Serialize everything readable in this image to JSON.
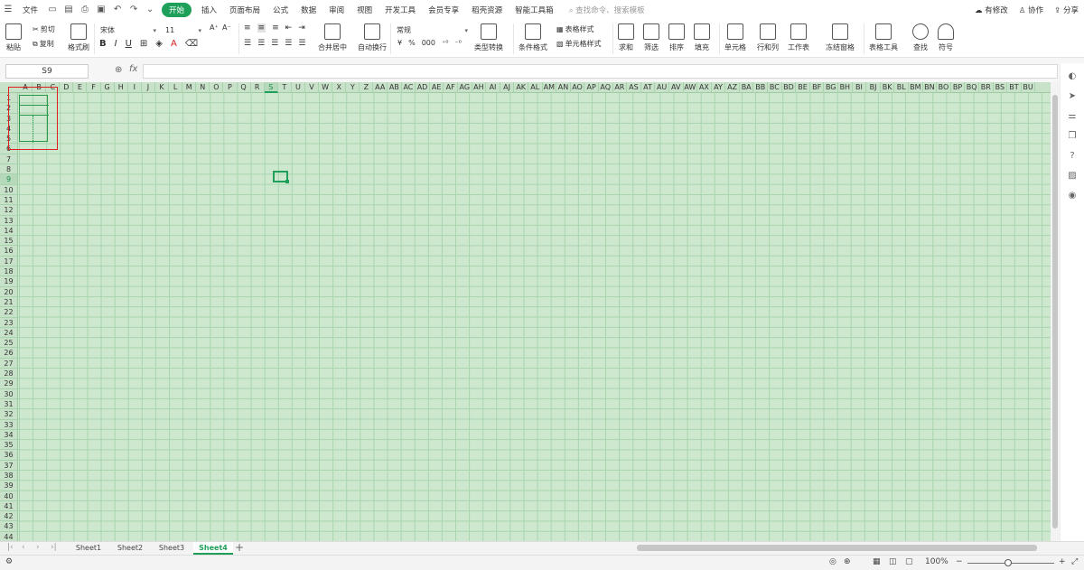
{
  "menubar": {
    "file": "文件",
    "tabs": [
      "开始",
      "插入",
      "页面布局",
      "公式",
      "数据",
      "审阅",
      "视图",
      "开发工具",
      "会员专享",
      "稻壳资源",
      "智能工具箱"
    ],
    "search_placeholder": "查找命令、搜索模板",
    "right": {
      "modify": "有修改",
      "collab": "协作",
      "share": "分享"
    }
  },
  "ribbon": {
    "paste": "粘贴",
    "cut": "剪切",
    "copy": "复制",
    "format_painter": "格式刷",
    "font_name": "宋体",
    "font_size": "11",
    "merge_center": "合并居中",
    "wrap_text": "自动换行",
    "number_format": "常规",
    "currency": "¥",
    "percent": "%",
    "thousands": "000",
    "type_convert": "类型转换",
    "cond_format": "条件格式",
    "table_style": "表格样式",
    "cell_style": "单元格样式",
    "sum": "求和",
    "filter": "筛选",
    "sort": "排序",
    "fill": "填充",
    "cell": "单元格",
    "row_col": "行和列",
    "worksheet": "工作表",
    "freeze": "冻结窗格",
    "table_tools": "表格工具",
    "find": "查找",
    "symbol": "符号"
  },
  "formula_bar": {
    "name_box": "S9",
    "fx": "fx",
    "value": ""
  },
  "grid": {
    "columns": [
      "A",
      "B",
      "C",
      "D",
      "E",
      "F",
      "G",
      "H",
      "I",
      "J",
      "K",
      "L",
      "M",
      "N",
      "O",
      "P",
      "Q",
      "R",
      "S",
      "T",
      "U",
      "V",
      "W",
      "X",
      "Y",
      "Z",
      "AA",
      "AB",
      "AC",
      "AD",
      "AE",
      "AF",
      "AG",
      "AH",
      "AI",
      "AJ",
      "AK",
      "AL",
      "AM",
      "AN",
      "AO",
      "AP",
      "AQ",
      "AR",
      "AS",
      "AT",
      "AU",
      "AV",
      "AW",
      "AX",
      "AY",
      "AZ",
      "BA",
      "BB",
      "BC",
      "BD",
      "BE",
      "BF",
      "BG",
      "BH",
      "BI",
      "BJ",
      "BK",
      "BL",
      "BM",
      "BN",
      "BO",
      "BP",
      "BQ",
      "BR",
      "BS",
      "BT",
      "BU"
    ],
    "rows": [
      "1",
      "2",
      "3",
      "4",
      "5",
      "6",
      "7",
      "8",
      "9",
      "10",
      "11",
      "12",
      "13",
      "14",
      "15",
      "16",
      "17",
      "18",
      "19",
      "20",
      "21",
      "22",
      "23",
      "24",
      "25",
      "26",
      "27",
      "28",
      "29",
      "30",
      "31",
      "32",
      "33",
      "34",
      "35",
      "36",
      "37",
      "38",
      "39",
      "40",
      "41",
      "42",
      "43",
      "44"
    ],
    "selected_col": "S",
    "selected_row": "9"
  },
  "sheets": [
    "Sheet1",
    "Sheet2",
    "Sheet3",
    "Sheet4"
  ],
  "active_sheet": "Sheet4",
  "status": {
    "zoom": "100%"
  }
}
